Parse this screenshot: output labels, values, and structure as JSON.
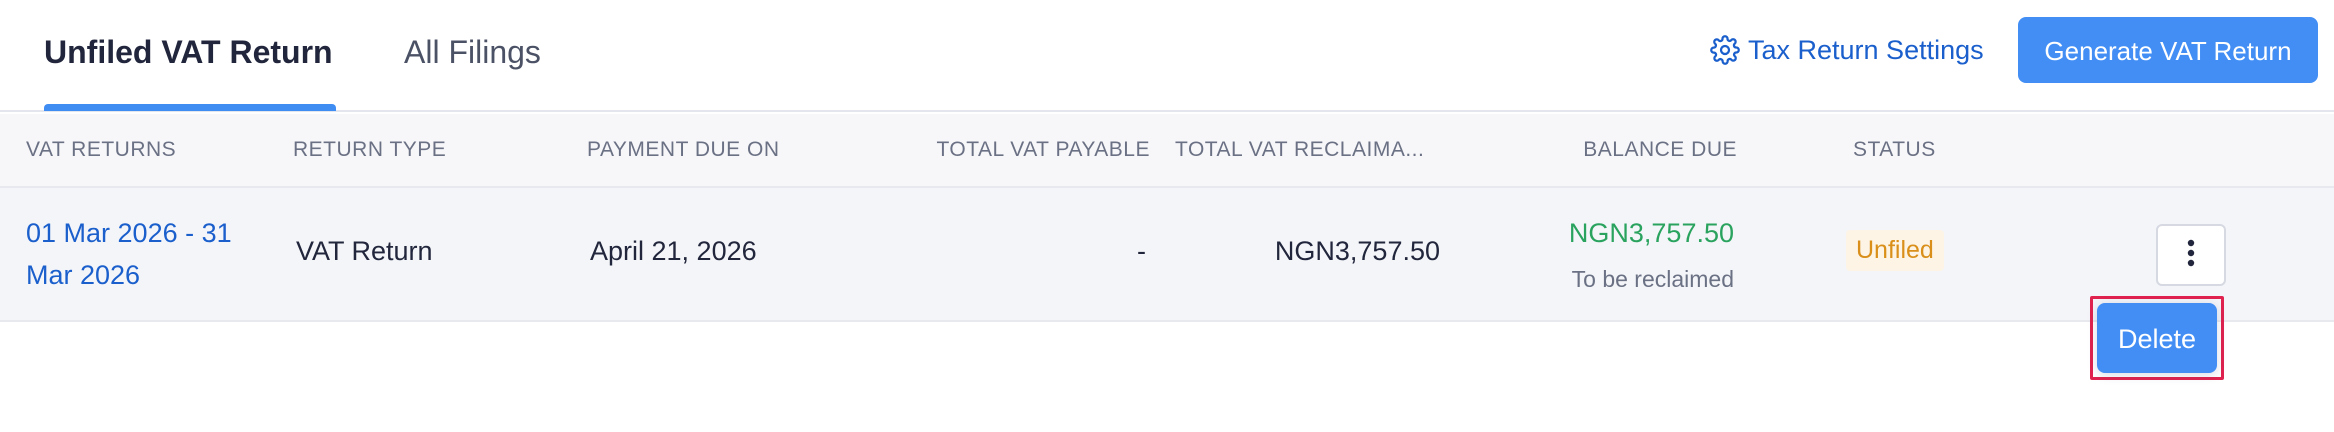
{
  "tabs": [
    {
      "label": "Unfiled VAT Return",
      "active": true
    },
    {
      "label": "All Filings",
      "active": false
    }
  ],
  "header_actions": {
    "settings_label": "Tax Return Settings",
    "settings_icon": "gear-icon",
    "generate_label": "Generate VAT Return"
  },
  "table": {
    "columns": [
      "VAT RETURNS",
      "RETURN TYPE",
      "PAYMENT DUE ON",
      "TOTAL VAT PAYABLE",
      "TOTAL VAT RECLAIMA...",
      "BALANCE DUE",
      "STATUS"
    ],
    "rows": [
      {
        "period": "01 Mar 2026 - 31 Mar 2026",
        "return_type": "VAT Return",
        "payment_due": "April 21, 2026",
        "total_vat_payable": "-",
        "total_vat_reclaimable": "NGN3,757.50",
        "balance_due": "NGN3,757.50",
        "balance_note": "To be reclaimed",
        "status": "Unfiled"
      }
    ]
  },
  "row_menu": {
    "icon": "more-vertical-icon",
    "delete_label": "Delete"
  },
  "colors": {
    "accent": "#428ef5",
    "link": "#1a5fcc",
    "positive": "#2aa35f",
    "status_unfiled": "#d98f19",
    "highlight": "#e0224f"
  }
}
